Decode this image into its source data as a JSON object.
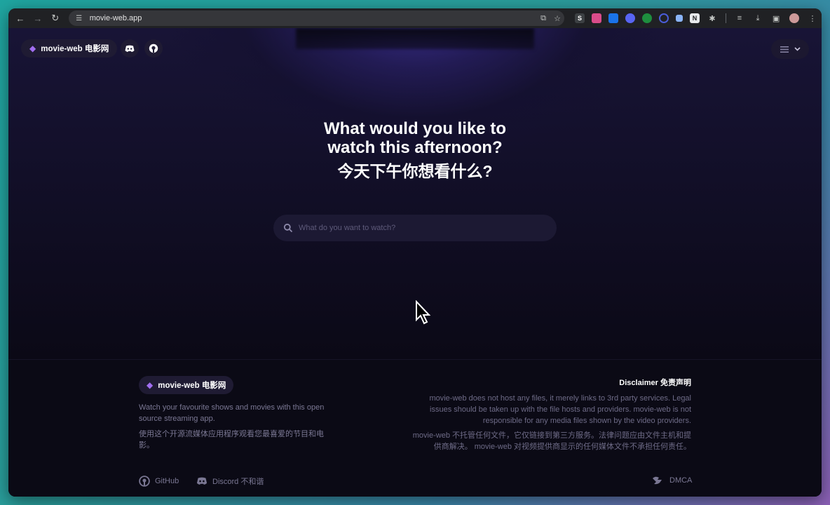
{
  "browser": {
    "url": "movie-web.app",
    "back_glyph": "←",
    "forward_glyph": "→",
    "reload_glyph": "↻"
  },
  "header": {
    "brand_label": "movie-web 电影网"
  },
  "hero": {
    "title_line1": "What would you like to",
    "title_line2": "watch this afternoon?",
    "title_zh": "今天下午你想看什么?"
  },
  "search": {
    "placeholder": "What do you want to watch?",
    "value": ""
  },
  "footer": {
    "brand_label": "movie-web 电影网",
    "tagline_en": "Watch your favourite shows and movies with this open source streaming app.",
    "tagline_zh": "使用这个开源流媒体应用程序观看您最喜爱的节目和电影。",
    "disclaimer_title": "Disclaimer 免责声明",
    "disclaimer_en": "movie-web does not host any files, it merely links to 3rd party services. Legal issues should be taken up with the file hosts and providers. movie-web is not responsible for any media files shown by the video providers.",
    "disclaimer_zh": "movie-web 不托管任何文件，它仅链接到第三方服务。法律问题应由文件主机和提供商解决。 movie-web 对视频提供商显示的任何媒体文件不承担任何责任。",
    "github_label": "GitHub",
    "discord_label": "Discord 不和谐",
    "dmca_label": "DMCA"
  },
  "colors": {
    "accent_purple": "#a16ef0",
    "page_bg": "#0b0916",
    "pill_bg": "#1f1b33"
  }
}
